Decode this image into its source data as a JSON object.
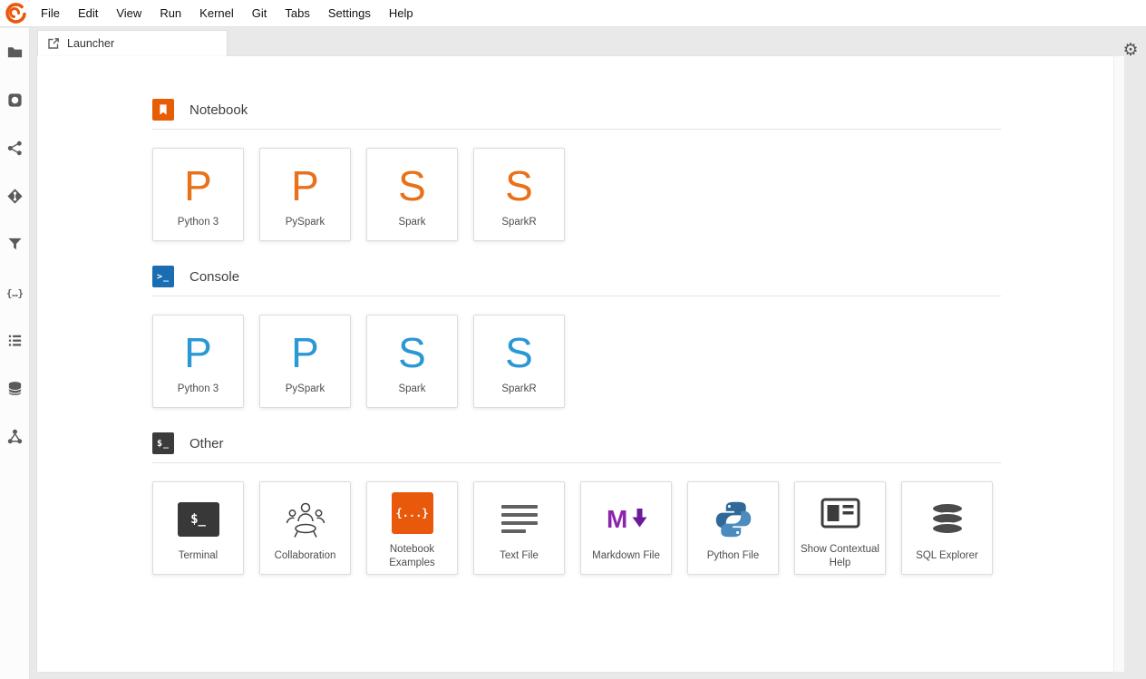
{
  "menubar": {
    "items": [
      "File",
      "Edit",
      "View",
      "Run",
      "Kernel",
      "Git",
      "Tabs",
      "Settings",
      "Help"
    ]
  },
  "tabbar": {
    "active_tab": "Launcher"
  },
  "launcher": {
    "sections": [
      {
        "title": "Notebook",
        "icon_bg": "#E85D04",
        "letter_color": "#E8711A",
        "cards": [
          {
            "letter": "P",
            "label": "Python 3"
          },
          {
            "letter": "P",
            "label": "PySpark"
          },
          {
            "letter": "S",
            "label": "Spark"
          },
          {
            "letter": "S",
            "label": "SparkR"
          }
        ]
      },
      {
        "title": "Console",
        "icon_bg": "#1A6DB0",
        "letter_color": "#2B98D6",
        "cards": [
          {
            "letter": "P",
            "label": "Python 3"
          },
          {
            "letter": "P",
            "label": "PySpark"
          },
          {
            "letter": "S",
            "label": "Spark"
          },
          {
            "letter": "S",
            "label": "SparkR"
          }
        ]
      },
      {
        "title": "Other",
        "icon_bg": "#3B3B3B",
        "cards": [
          {
            "label": "Terminal"
          },
          {
            "label": "Collaboration"
          },
          {
            "label": "Notebook Examples"
          },
          {
            "label": "Text File"
          },
          {
            "label": "Markdown File"
          },
          {
            "label": "Python File"
          },
          {
            "label": "Show Contextual Help"
          },
          {
            "label": "SQL Explorer"
          }
        ]
      }
    ]
  },
  "glyphs": {
    "console": ">_",
    "other": "$_",
    "terminal": "$_",
    "braces": "{...}",
    "markdown_letter": "M",
    "gear": "⚙"
  },
  "colors": {
    "accent_orange": "#E8590C",
    "console_blue": "#1A6DB0",
    "markdown_purple": "#8E24AA",
    "markdown_arrow": "#6A1B9A",
    "python_dark": "#306998",
    "python_light": "#4B8BBE"
  }
}
